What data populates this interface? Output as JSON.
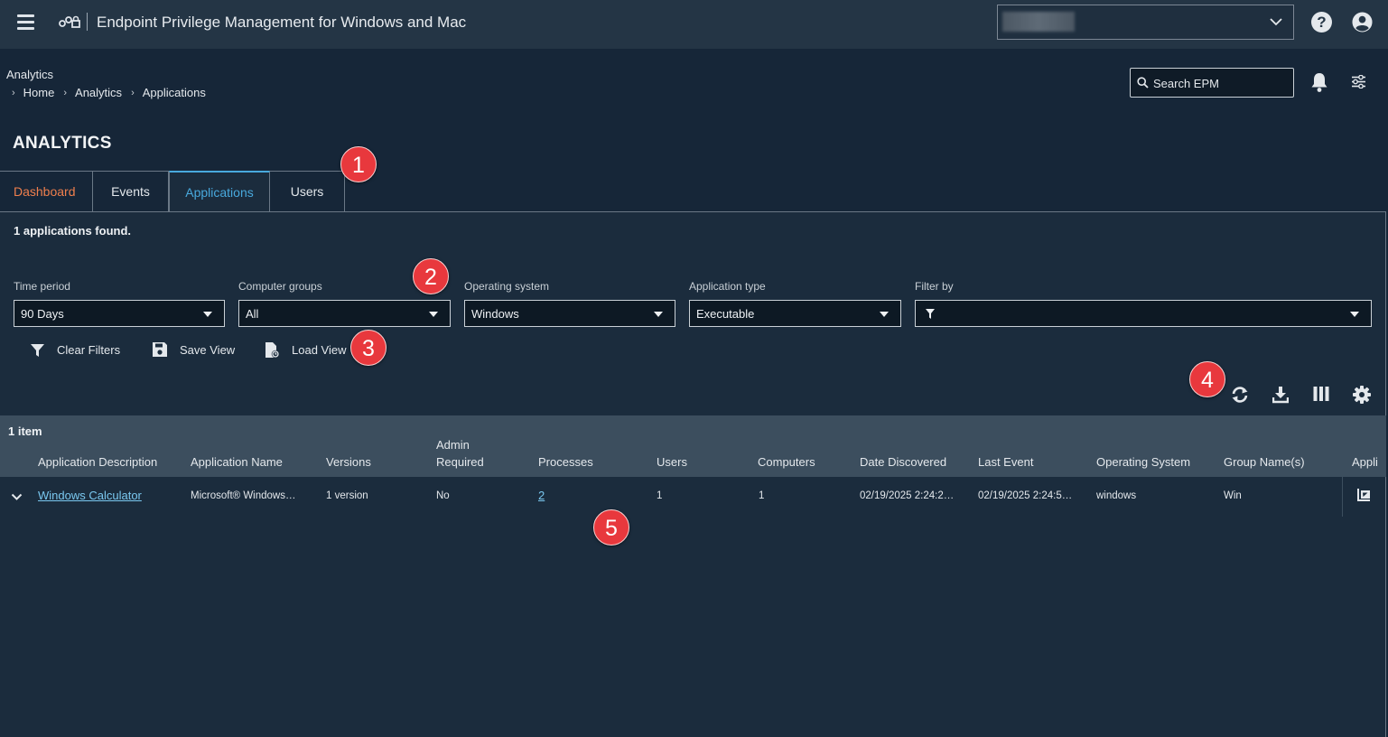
{
  "header": {
    "app_title": "Endpoint Privilege Management for Windows and Mac"
  },
  "breadcrumb": {
    "root": "Analytics",
    "items": [
      "Home",
      "Analytics",
      "Applications"
    ]
  },
  "search": {
    "placeholder": "Search EPM"
  },
  "page_title": "ANALYTICS",
  "tabs": [
    {
      "label": "Dashboard"
    },
    {
      "label": "Events"
    },
    {
      "label": "Applications",
      "active": true
    },
    {
      "label": "Users"
    }
  ],
  "results": {
    "found_text": "1 applications found."
  },
  "filters": [
    {
      "label": "Time period",
      "value": "90 Days"
    },
    {
      "label": "Computer groups",
      "value": "All"
    },
    {
      "label": "Operating system",
      "value": "Windows"
    },
    {
      "label": "Application type",
      "value": "Executable"
    },
    {
      "label": "Filter by",
      "value": ""
    }
  ],
  "actions": {
    "clear_filters": "Clear Filters",
    "save_view": "Save View",
    "load_view": "Load View"
  },
  "toolbar_icons": [
    "refresh-icon",
    "download-icon",
    "columns-icon",
    "gear-icon"
  ],
  "table": {
    "item_count": "1 item",
    "columns": [
      "Application Description",
      "Application Name",
      "Versions",
      "Admin Required",
      "Processes",
      "Users",
      "Computers",
      "Date Discovered",
      "Last Event",
      "Operating System",
      "Group Name(s)",
      "Appli"
    ],
    "rows": [
      {
        "description": "Windows Calculator",
        "name": "Microsoft® Windows…",
        "versions": "1 version",
        "admin_required": "No",
        "processes": "2",
        "users": "1",
        "computers": "1",
        "date_discovered": "02/19/2025 2:24:2…",
        "last_event": "02/19/2025 2:24:5…",
        "os": "windows",
        "group": "Win"
      }
    ]
  },
  "callouts": [
    "1",
    "2",
    "3",
    "4",
    "5"
  ],
  "colors": {
    "topbar": "#243545",
    "background": "#162638",
    "panel": "#1b2c3d",
    "active_tab": "#48a9dd",
    "dashboard_tab": "#f07f4d",
    "link": "#7ac8f0",
    "callout": "#e8383d"
  }
}
